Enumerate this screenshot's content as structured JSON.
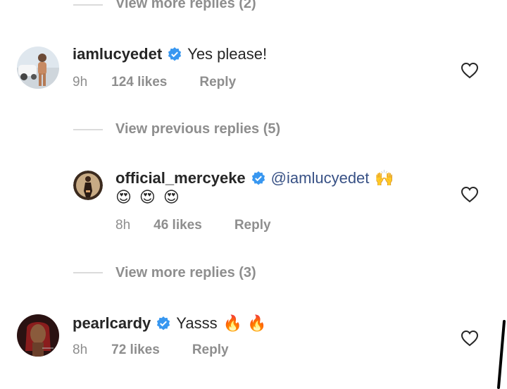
{
  "threads": {
    "top_more": "View more replies (2)",
    "previous": "View previous replies (5)",
    "mid_more": "View more replies (3)"
  },
  "comments": [
    {
      "username": "iamlucyedet",
      "text": "Yes please!",
      "time": "9h",
      "likes": "124 likes",
      "reply": "Reply"
    },
    {
      "username": "official_mercyeke",
      "mention": "@iamlucyedet",
      "emoji_line1": "🙌",
      "emoji_line2": "😍 😍 😍",
      "time": "8h",
      "likes": "46 likes",
      "reply": "Reply"
    },
    {
      "username": "pearlcardy",
      "text": "Yasss",
      "emoji": "🔥 🔥",
      "time": "8h",
      "likes": "72 likes",
      "reply": "Reply"
    }
  ],
  "colors": {
    "verified": "#3897f0",
    "secondary_text": "#8e8e8e",
    "mention": "#385185"
  }
}
